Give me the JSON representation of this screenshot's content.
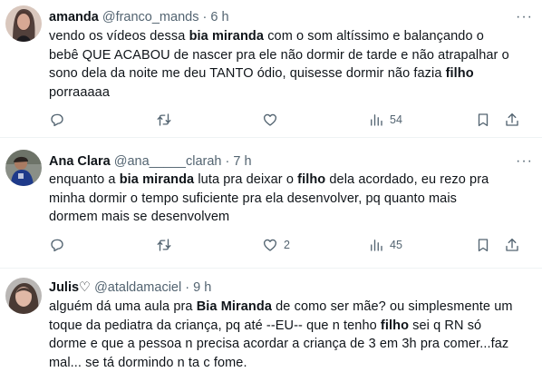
{
  "tweets": [
    {
      "name": "amanda",
      "handle": "@franco_mands",
      "dot": "·",
      "time": "6 h",
      "more": "···",
      "text": {
        "l1a": "vendo os vídeos dessa ",
        "l1b": "bia miranda",
        "l1c": " com o som altíssimo e balançando o",
        "l2": "bebê QUE ACABOU de nascer pra ele não dormir de tarde e não atrapalhar o",
        "l3a": "sono dela da noite me deu TANTO ódio, quisesse dormir não fazia ",
        "l3b": "filho",
        "l4": "porraaaaa"
      },
      "counts": {
        "reply": "",
        "retweet": "",
        "like": "",
        "views": "54"
      }
    },
    {
      "name": "Ana Clara",
      "handle": "@ana_____clarah",
      "dot": "·",
      "time": "7 h",
      "more": "···",
      "text": {
        "l1a": "enquanto a ",
        "l1b": "bia miranda",
        "l1c": " luta pra deixar o ",
        "l1d": "filho",
        "l1e": " dela acordado, eu rezo pra",
        "l2": "minha dormir o tempo suficiente pra ela desenvolver, pq quanto mais",
        "l3": "dormem mais se desenvolvem"
      },
      "counts": {
        "reply": "",
        "retweet": "",
        "like": "2",
        "views": "45"
      }
    },
    {
      "name": "Julis♡",
      "handle": "@ataldamaciel",
      "dot": "·",
      "time": "9 h",
      "text": {
        "l1a": "alguém dá uma aula pra ",
        "l1b": "Bia Miranda",
        "l1c": " de como ser mãe? ou simplesmente um",
        "l2": "toque da pediatra da criança, pq até --EU-- que n tenho ",
        "l2b": "filho",
        "l2c": " sei q RN só",
        "l3": "dorme e que a pessoa n precisa acordar a criança de 3 em 3h pra comer...faz",
        "l4": "mal... se tá dormindo n ta c fome."
      }
    }
  ]
}
